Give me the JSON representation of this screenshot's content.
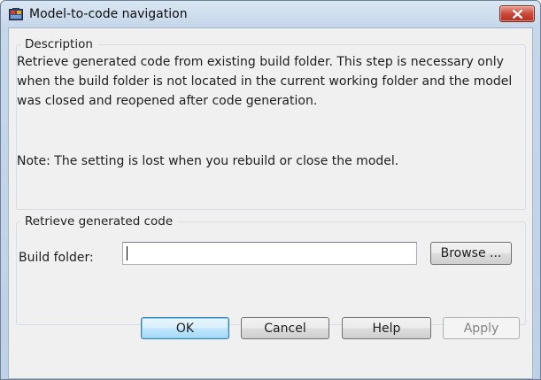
{
  "window": {
    "title": "Model-to-code navigation",
    "app_icon": "simulink-model-icon",
    "close_icon": "close-icon"
  },
  "description_group": {
    "legend": "Description",
    "text": "Retrieve generated code from existing build folder. This step is necessary only when the build folder is not located in the current working folder and the model was closed and reopened after code generation.",
    "note": "Note: The setting is lost when you rebuild or close the model."
  },
  "retrieve_group": {
    "legend": "Retrieve generated code",
    "build_folder_label": "Build folder:",
    "build_folder_value": "",
    "browse_label": "Browse ..."
  },
  "buttons": {
    "ok": "OK",
    "cancel": "Cancel",
    "help": "Help",
    "apply": "Apply"
  },
  "colors": {
    "close_button": "#c9493a",
    "default_button_border": "#3c7fb1",
    "disabled_text": "#838383"
  }
}
